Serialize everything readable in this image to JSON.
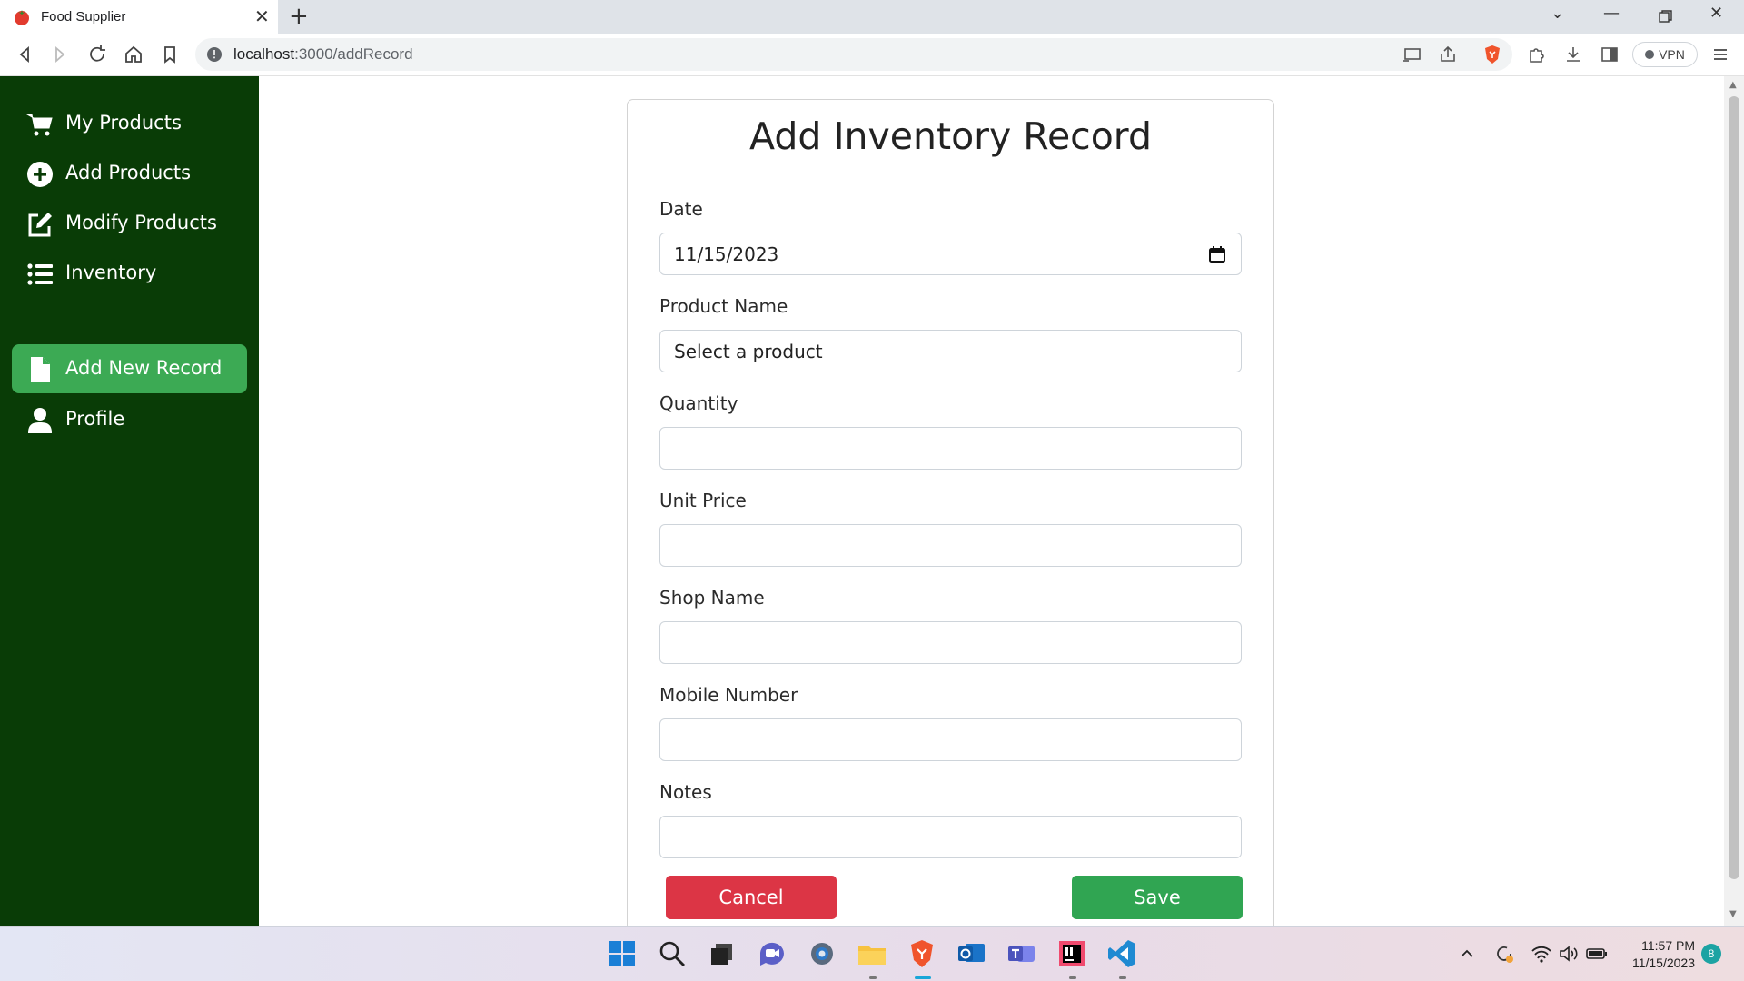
{
  "browser": {
    "tab_title": "Food Supplier",
    "url_host": "localhost",
    "url_rest": ":3000/addRecord",
    "vpn_label": "VPN"
  },
  "sidebar": {
    "items": [
      {
        "label": "My Products",
        "icon": "cart-icon",
        "active": false
      },
      {
        "label": "Add Products",
        "icon": "plus-circle-icon",
        "active": false
      },
      {
        "label": "Modify Products",
        "icon": "edit-icon",
        "active": false
      },
      {
        "label": "Inventory",
        "icon": "list-icon",
        "active": false
      },
      {
        "label": "Add New Record",
        "icon": "file-icon",
        "active": true
      },
      {
        "label": "Profile",
        "icon": "user-icon",
        "active": false
      }
    ]
  },
  "form": {
    "title": "Add Inventory Record",
    "fields": {
      "date": {
        "label": "Date",
        "value": "11/15/2023"
      },
      "product": {
        "label": "Product Name",
        "value": "Select a product"
      },
      "quantity": {
        "label": "Quantity",
        "value": ""
      },
      "unit_price": {
        "label": "Unit Price",
        "value": ""
      },
      "shop_name": {
        "label": "Shop Name",
        "value": ""
      },
      "mobile": {
        "label": "Mobile Number",
        "value": ""
      },
      "notes": {
        "label": "Notes",
        "value": ""
      }
    },
    "cancel_label": "Cancel",
    "save_label": "Save"
  },
  "taskbar": {
    "time": "11:57 PM",
    "date": "11/15/2023",
    "notification_count": "8"
  },
  "colors": {
    "sidebar_bg": "#093c06",
    "sidebar_active": "#3caa54",
    "cancel": "#dc3545",
    "save": "#30a552"
  }
}
